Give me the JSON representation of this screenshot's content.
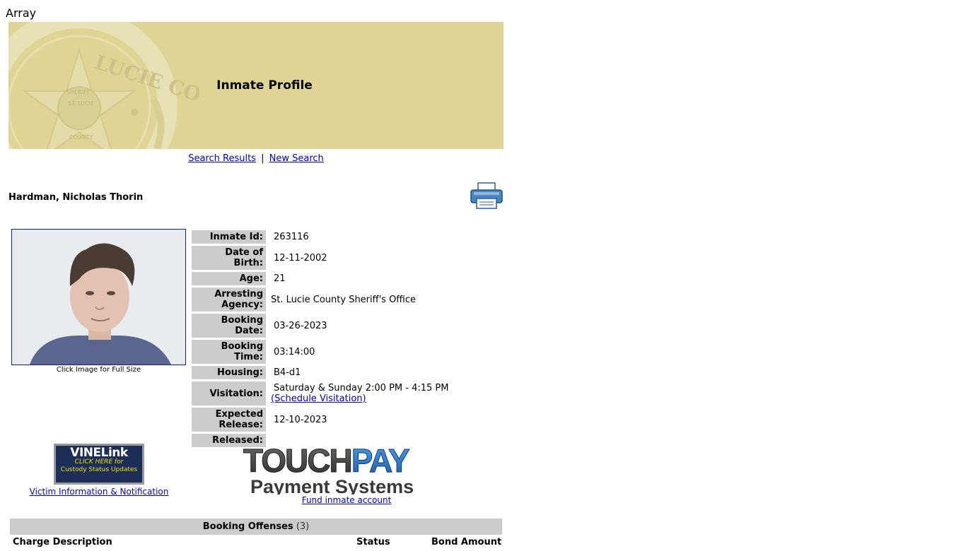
{
  "page": {
    "top_text": "Array"
  },
  "banner": {
    "title": "Inmate Profile",
    "seal_text": "LUCIE COUNTY",
    "seal_inner_top": "SHERIFF",
    "seal_inner_mid": "ST. LUCIE",
    "seal_inner_bottom": "COUNTY",
    "colors": {
      "background": "#ded595"
    }
  },
  "nav": {
    "search_results": "Search Results",
    "separator": "|",
    "new_search": "New Search"
  },
  "inmate": {
    "name": "Hardman, Nicholas Thorin"
  },
  "photo": {
    "caption": "Click Image for Full Size"
  },
  "info_rows": [
    {
      "label": "Inmate Id:",
      "value": "263116"
    },
    {
      "label": "Date of Birth:",
      "value": "12-11-2002"
    },
    {
      "label": "Age:",
      "value": "21"
    },
    {
      "label": "Arresting Agency:",
      "value": "St. Lucie County Sheriff's Office"
    },
    {
      "label": "Booking Date:",
      "value": "03-26-2023"
    },
    {
      "label": "Booking Time:",
      "value": "03:14:00"
    },
    {
      "label": "Housing:",
      "value": "B4-d1"
    },
    {
      "label": "Visitation:",
      "value": "Saturday & Sunday 2:00 PM - 4:15 PM",
      "link": "(Schedule Visitation)"
    },
    {
      "label": "Expected Release:",
      "value": "12-10-2023"
    },
    {
      "label": "Released:",
      "value": ""
    }
  ],
  "vine": {
    "logo": "VINELink",
    "click_here": "CLICK HERE for",
    "custody": "Custody Status Updates",
    "link": "Victim Information & Notification"
  },
  "touchpay": {
    "logo_top": "TOUCHPAY",
    "logo_bottom": "Payment Systems",
    "link": "Fund inmate account"
  },
  "offenses": {
    "title": "Booking Offenses",
    "count": "(3)",
    "headers": [
      "Charge Description",
      "Status",
      "Bond Amount"
    ]
  }
}
